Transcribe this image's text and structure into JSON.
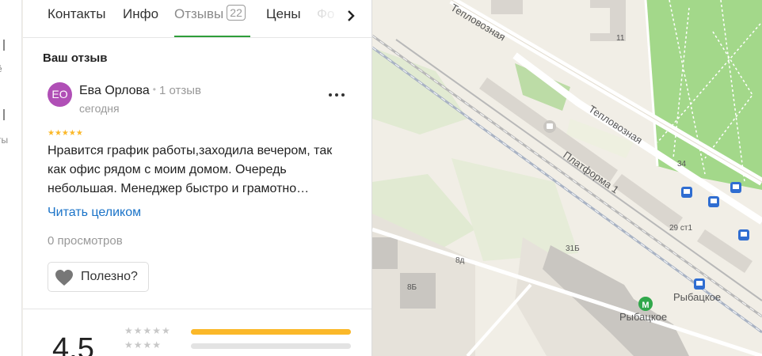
{
  "rail": {
    "fragment_1": "ё",
    "fragment_2": "ты"
  },
  "tabs": [
    {
      "label": "Контакты"
    },
    {
      "label": "Инфо"
    },
    {
      "label": "Отзывы",
      "count": "22"
    },
    {
      "label": "Цены"
    },
    {
      "label": "Фо"
    }
  ],
  "section_title": "Ваш отзыв",
  "review": {
    "avatar_initials": "ЕО",
    "author": "Ева Орлова",
    "author_reviews": "1 отзыв",
    "date": "сегодня",
    "rating": 5,
    "stars": "★★★★★",
    "text": "Нравится график работы,заходила вечером, так как офис рядом с моим домом. Очередь небольшая. Менеджер быстро и грамотно…",
    "read_more": "Читать целиком",
    "views": "0 просмотров",
    "useful_label": "Полезно?"
  },
  "rating_summary": {
    "value": "4.5",
    "distribution": [
      {
        "stars": "★★★★★",
        "fraction": 1.0
      },
      {
        "stars": "★★★★",
        "fraction": 0.0
      }
    ]
  },
  "map": {
    "labels": {
      "street_1": "Тепловозная",
      "street_2": "Тепловозная",
      "platform": "Платформа 1",
      "station": "Рыбацкое",
      "stop": "Рыбацкое",
      "b11": "11",
      "b34": "34",
      "b29": "29 ст1",
      "b31": "31Б",
      "b8d": "8д",
      "b8b": "8Б",
      "metro": "М"
    }
  },
  "colors": {
    "accent_green": "#2e9e3a",
    "star": "#fbb829",
    "link": "#1a73c8",
    "avatar": "#b04fb6",
    "park": "#a3d88a"
  }
}
